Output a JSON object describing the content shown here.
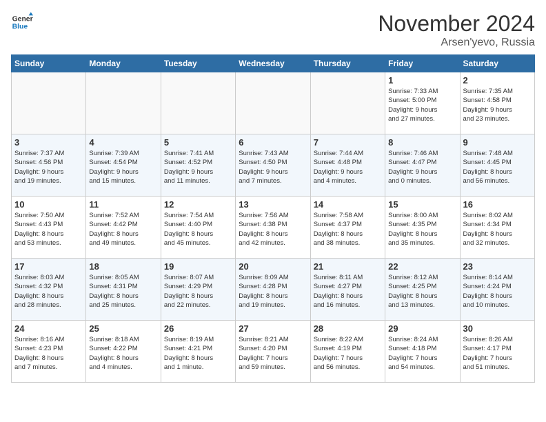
{
  "logo": {
    "line1": "General",
    "line2": "Blue"
  },
  "title": "November 2024",
  "location": "Arsen'yevo, Russia",
  "weekdays": [
    "Sunday",
    "Monday",
    "Tuesday",
    "Wednesday",
    "Thursday",
    "Friday",
    "Saturday"
  ],
  "weeks": [
    [
      {
        "day": "",
        "info": ""
      },
      {
        "day": "",
        "info": ""
      },
      {
        "day": "",
        "info": ""
      },
      {
        "day": "",
        "info": ""
      },
      {
        "day": "",
        "info": ""
      },
      {
        "day": "1",
        "info": "Sunrise: 7:33 AM\nSunset: 5:00 PM\nDaylight: 9 hours\nand 27 minutes."
      },
      {
        "day": "2",
        "info": "Sunrise: 7:35 AM\nSunset: 4:58 PM\nDaylight: 9 hours\nand 23 minutes."
      }
    ],
    [
      {
        "day": "3",
        "info": "Sunrise: 7:37 AM\nSunset: 4:56 PM\nDaylight: 9 hours\nand 19 minutes."
      },
      {
        "day": "4",
        "info": "Sunrise: 7:39 AM\nSunset: 4:54 PM\nDaylight: 9 hours\nand 15 minutes."
      },
      {
        "day": "5",
        "info": "Sunrise: 7:41 AM\nSunset: 4:52 PM\nDaylight: 9 hours\nand 11 minutes."
      },
      {
        "day": "6",
        "info": "Sunrise: 7:43 AM\nSunset: 4:50 PM\nDaylight: 9 hours\nand 7 minutes."
      },
      {
        "day": "7",
        "info": "Sunrise: 7:44 AM\nSunset: 4:48 PM\nDaylight: 9 hours\nand 4 minutes."
      },
      {
        "day": "8",
        "info": "Sunrise: 7:46 AM\nSunset: 4:47 PM\nDaylight: 9 hours\nand 0 minutes."
      },
      {
        "day": "9",
        "info": "Sunrise: 7:48 AM\nSunset: 4:45 PM\nDaylight: 8 hours\nand 56 minutes."
      }
    ],
    [
      {
        "day": "10",
        "info": "Sunrise: 7:50 AM\nSunset: 4:43 PM\nDaylight: 8 hours\nand 53 minutes."
      },
      {
        "day": "11",
        "info": "Sunrise: 7:52 AM\nSunset: 4:42 PM\nDaylight: 8 hours\nand 49 minutes."
      },
      {
        "day": "12",
        "info": "Sunrise: 7:54 AM\nSunset: 4:40 PM\nDaylight: 8 hours\nand 45 minutes."
      },
      {
        "day": "13",
        "info": "Sunrise: 7:56 AM\nSunset: 4:38 PM\nDaylight: 8 hours\nand 42 minutes."
      },
      {
        "day": "14",
        "info": "Sunrise: 7:58 AM\nSunset: 4:37 PM\nDaylight: 8 hours\nand 38 minutes."
      },
      {
        "day": "15",
        "info": "Sunrise: 8:00 AM\nSunset: 4:35 PM\nDaylight: 8 hours\nand 35 minutes."
      },
      {
        "day": "16",
        "info": "Sunrise: 8:02 AM\nSunset: 4:34 PM\nDaylight: 8 hours\nand 32 minutes."
      }
    ],
    [
      {
        "day": "17",
        "info": "Sunrise: 8:03 AM\nSunset: 4:32 PM\nDaylight: 8 hours\nand 28 minutes."
      },
      {
        "day": "18",
        "info": "Sunrise: 8:05 AM\nSunset: 4:31 PM\nDaylight: 8 hours\nand 25 minutes."
      },
      {
        "day": "19",
        "info": "Sunrise: 8:07 AM\nSunset: 4:29 PM\nDaylight: 8 hours\nand 22 minutes."
      },
      {
        "day": "20",
        "info": "Sunrise: 8:09 AM\nSunset: 4:28 PM\nDaylight: 8 hours\nand 19 minutes."
      },
      {
        "day": "21",
        "info": "Sunrise: 8:11 AM\nSunset: 4:27 PM\nDaylight: 8 hours\nand 16 minutes."
      },
      {
        "day": "22",
        "info": "Sunrise: 8:12 AM\nSunset: 4:25 PM\nDaylight: 8 hours\nand 13 minutes."
      },
      {
        "day": "23",
        "info": "Sunrise: 8:14 AM\nSunset: 4:24 PM\nDaylight: 8 hours\nand 10 minutes."
      }
    ],
    [
      {
        "day": "24",
        "info": "Sunrise: 8:16 AM\nSunset: 4:23 PM\nDaylight: 8 hours\nand 7 minutes."
      },
      {
        "day": "25",
        "info": "Sunrise: 8:18 AM\nSunset: 4:22 PM\nDaylight: 8 hours\nand 4 minutes."
      },
      {
        "day": "26",
        "info": "Sunrise: 8:19 AM\nSunset: 4:21 PM\nDaylight: 8 hours\nand 1 minute."
      },
      {
        "day": "27",
        "info": "Sunrise: 8:21 AM\nSunset: 4:20 PM\nDaylight: 7 hours\nand 59 minutes."
      },
      {
        "day": "28",
        "info": "Sunrise: 8:22 AM\nSunset: 4:19 PM\nDaylight: 7 hours\nand 56 minutes."
      },
      {
        "day": "29",
        "info": "Sunrise: 8:24 AM\nSunset: 4:18 PM\nDaylight: 7 hours\nand 54 minutes."
      },
      {
        "day": "30",
        "info": "Sunrise: 8:26 AM\nSunset: 4:17 PM\nDaylight: 7 hours\nand 51 minutes."
      }
    ]
  ]
}
